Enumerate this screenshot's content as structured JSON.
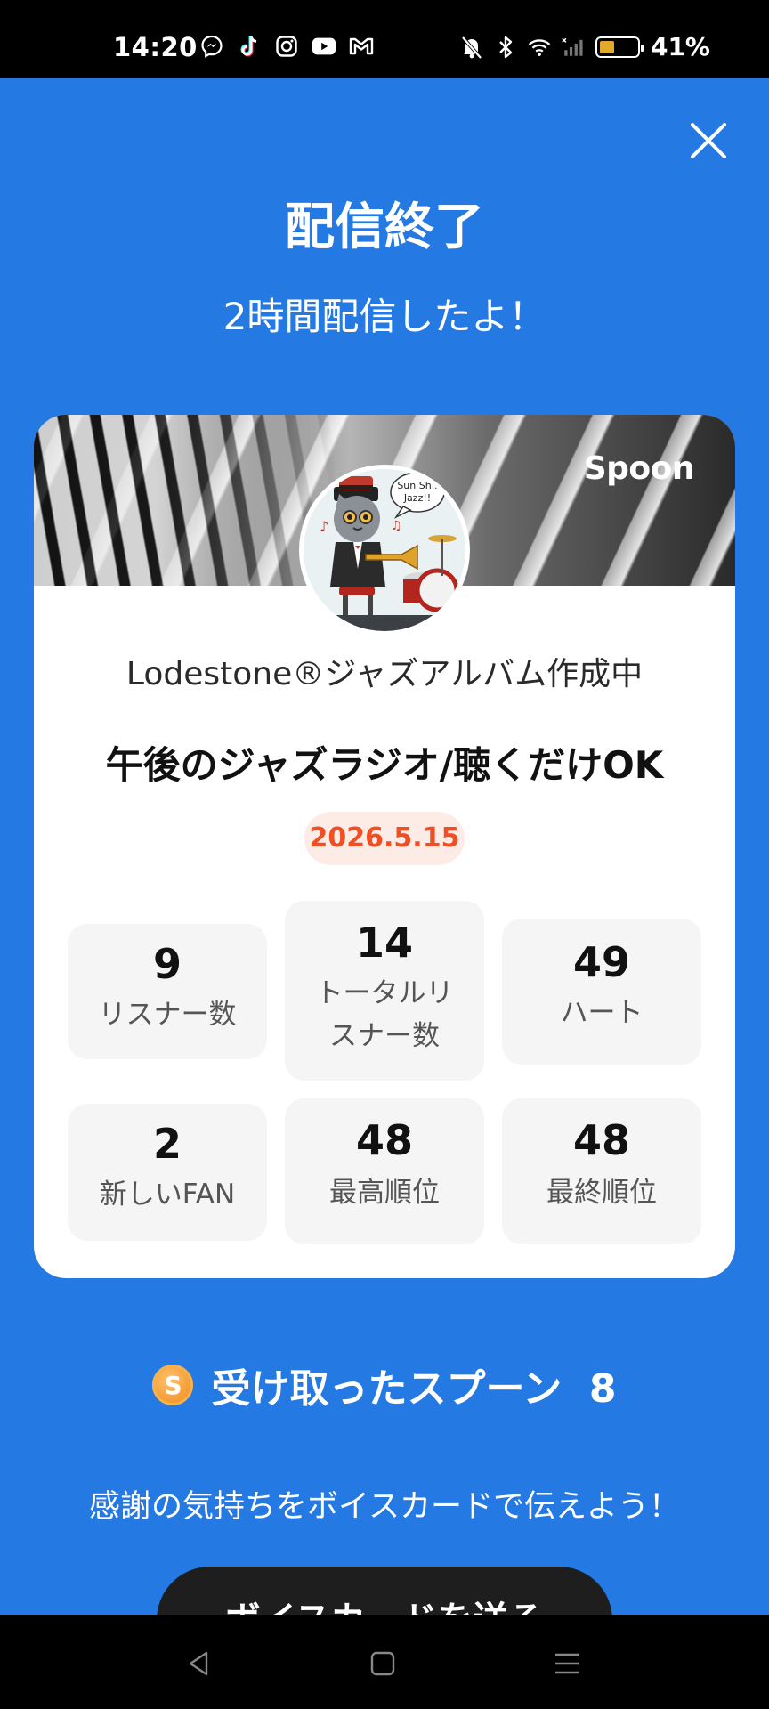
{
  "status_bar": {
    "time": "14:20",
    "battery_level": 0.41,
    "battery_text": "41%",
    "app_icons": [
      "messenger-icon",
      "tiktok-icon",
      "instagram-icon",
      "youtube-icon",
      "gmail-icon"
    ],
    "system_icons": [
      "mute-icon",
      "bluetooth-icon",
      "wifi-icon",
      "signal-icon",
      "battery-icon"
    ]
  },
  "header": {
    "title": "配信終了",
    "subtitle": "2時間配信したよ！",
    "close_icon": "close-icon"
  },
  "card": {
    "brand": "Spoon",
    "dj_name": "Lodestone®ジャズアルバム作成中",
    "show_title": "午後のジャズラジオ/聴くだけOK",
    "date": "2026.5.15",
    "avatar_bubble_text": "Sun Sh.. Jazz!!",
    "stats": [
      {
        "value": "9",
        "label": "リスナー数"
      },
      {
        "value": "14",
        "label": "トータルリスナー数",
        "label_line1": "トータルリ",
        "label_line2": "スナー数"
      },
      {
        "value": "49",
        "label": "ハート"
      },
      {
        "value": "2",
        "label": "新しいFAN"
      },
      {
        "value": "48",
        "label": "最高順位"
      },
      {
        "value": "48",
        "label": "最終順位"
      }
    ]
  },
  "spoons": {
    "coin_letter": "S",
    "text": "受け取ったスプーン  8"
  },
  "thanks_text": "感謝の気持ちをボイスカードで伝えよう！",
  "voice_card_button": "ボイスカードを送る",
  "colors": {
    "background": "#2479E3",
    "date_text": "#F04E23",
    "date_bg": "#FDEBE6",
    "stat_bg": "#F5F5F5",
    "coin": "#F08A1C"
  },
  "nav": [
    "back-icon",
    "home-icon",
    "menu-icon"
  ]
}
